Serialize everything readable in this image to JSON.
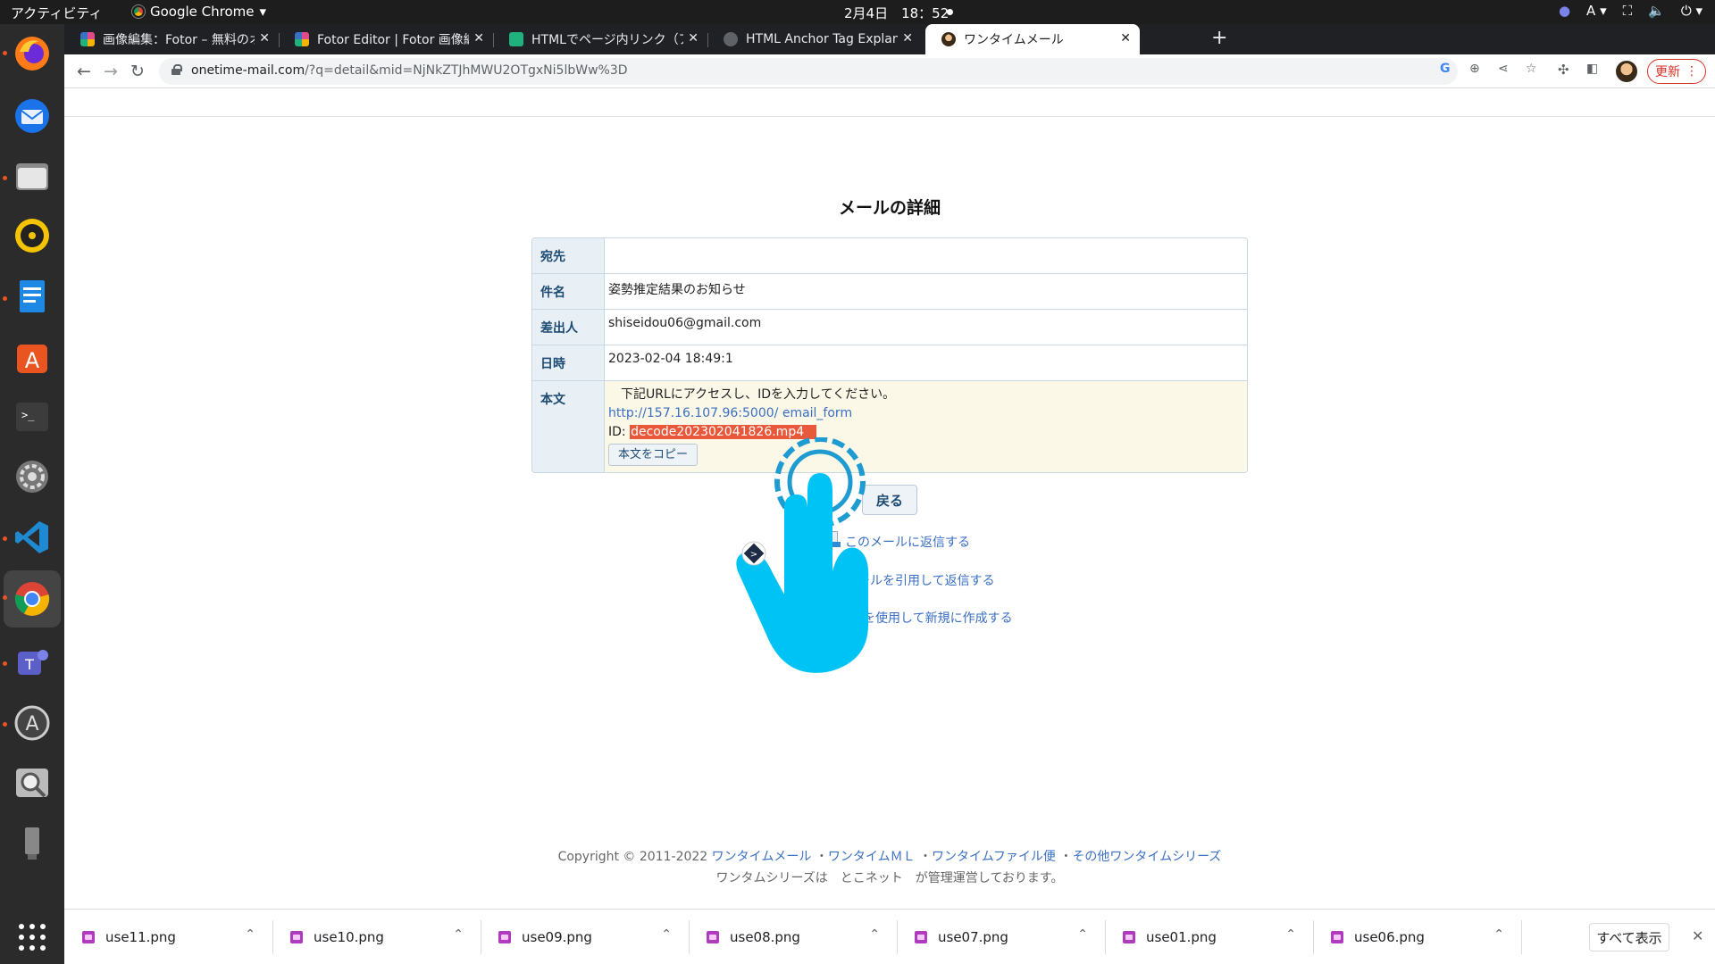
{
  "system": {
    "activities": "アクティビティ",
    "app_name": "Google Chrome",
    "clock": "2月4日　18：52",
    "input_method": "A"
  },
  "tabs": [
    {
      "title": "画像編集：Fotor – 無料のオ",
      "favicon": "fotor-icon",
      "color": "#e04a8a"
    },
    {
      "title": "Fotor Editor | Fotor 画像編",
      "favicon": "fotor-icon",
      "color": "#e04a8a"
    },
    {
      "title": "HTMLでページ内リンク（ア",
      "favicon": "html-site-icon",
      "color": "#22b07d"
    },
    {
      "title": "HTML Anchor Tag Explana",
      "favicon": "openai-icon",
      "color": "#5f6368"
    },
    {
      "title": "ワンタイムメール",
      "favicon": "onetime-icon",
      "color": "#3a2a1a"
    }
  ],
  "toolbar": {
    "url_host": "onetime-mail.com",
    "url_rest": "/?q=detail&mid=NjNkZTJhMWU2OTgxNi5lbWw%3D",
    "update_label": "更新"
  },
  "page": {
    "title": "メールの詳細",
    "fields": [
      {
        "label": "宛先",
        "value": ""
      },
      {
        "label": "件名",
        "value": "姿勢推定結果のお知らせ"
      },
      {
        "label": "差出人",
        "value": "shiseidou06@gmail.com"
      },
      {
        "label": "日時",
        "value": "2023-02-04 18:49:1"
      }
    ],
    "body_label": "本文",
    "body_line1": "　下記URLにアクセスし、IDを入力してください。",
    "body_link": "http://157.16.107.96:5000/ email_form",
    "body_id_prefix": "ID: ",
    "body_id_value": "decode202302041826.mp4",
    "copy_button": "本文をコピー",
    "back_button": "戻る",
    "actions": [
      "このメールに返信する",
      "このメールを引用して返信する",
      "このメールを使用して新規に作成する"
    ],
    "footer_copyright": "Copyright © 2011-2022",
    "footer_links": [
      "ワンタイムメール",
      "ワンタイムＭＬ",
      "ワンタイムファイル便",
      "その他ワンタイムシリーズ"
    ],
    "footer_line2": "ワンタムシリーズは　とこネット　が管理運営しております。"
  },
  "downloads": {
    "items": [
      "use11.png",
      "use10.png",
      "use09.png",
      "use08.png",
      "use07.png",
      "use01.png",
      "use06.png"
    ],
    "show_all": "すべて表示"
  },
  "colors": {
    "accent_link": "#3a6fc4",
    "id_highlight": "#e8583a",
    "pointer": "#00c3f5"
  }
}
